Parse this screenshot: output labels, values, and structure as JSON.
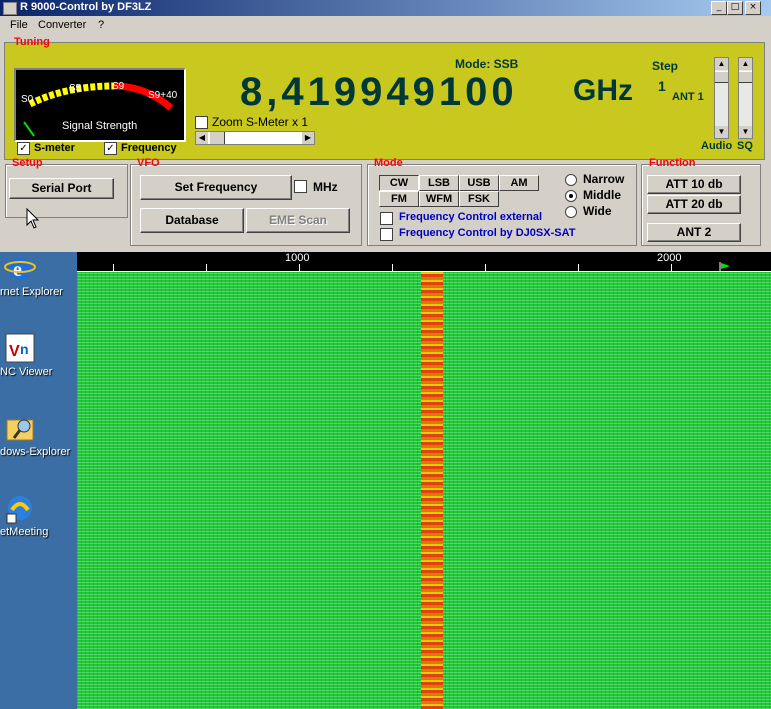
{
  "window": {
    "title": "R 9000-Control by DF3LZ"
  },
  "menu": [
    "File",
    "Converter",
    "?"
  ],
  "tuning": {
    "group_label": "Tuning",
    "meter": {
      "labels": [
        "S0",
        "S5",
        "S9",
        "S9+40"
      ],
      "caption": "Signal Strength"
    },
    "mode_label": "Mode:  SSB",
    "frequency": "8,419949100",
    "unit": "GHz",
    "step_label": "Step",
    "step_value": "1",
    "antenna": "ANT 1",
    "zoom_label": "Zoom S-Meter x 1",
    "smeter_check": "S-meter",
    "frequency_check": "Frequency",
    "audio_label": "Audio",
    "sq_label": "SQ"
  },
  "setup": {
    "label": "Setup",
    "serial_port": "Serial Port"
  },
  "vfo": {
    "label": "VFO",
    "set_frequency": "Set Frequency",
    "mhz": "MHz",
    "database": "Database",
    "eme_scan": "EME Scan"
  },
  "mode": {
    "label": "Mode",
    "buttons": [
      "CW",
      "LSB",
      "USB",
      "AM",
      "FM",
      "WFM",
      "FSK"
    ],
    "bandwidth": [
      "Narrow",
      "Middle",
      "Wide"
    ],
    "selected_bandwidth": "Middle",
    "fc_external": "Frequency Control external",
    "fc_dj0sx": "Frequency Control by DJ0SX-SAT"
  },
  "function": {
    "label": "Function",
    "att10": "ATT 10 db",
    "att20": "ATT 20 db",
    "ant2": "ANT 2"
  },
  "waterfall": {
    "ticks": [
      "1000",
      "2000"
    ]
  },
  "desktop": [
    {
      "label": "rnet Explorer",
      "icon": "internet-explorer-icon"
    },
    {
      "label": "NC Viewer",
      "icon": "vnc-viewer-icon"
    },
    {
      "label": "dows-Explorer",
      "icon": "windows-explorer-icon"
    },
    {
      "label": "etMeeting",
      "icon": "netmeeting-icon"
    }
  ],
  "colors": {
    "panel": "#c8c81e",
    "accent_red": "#ff0000",
    "digits": "#003838",
    "waterfall": "#22c83a",
    "signal": "#ff2a00"
  }
}
